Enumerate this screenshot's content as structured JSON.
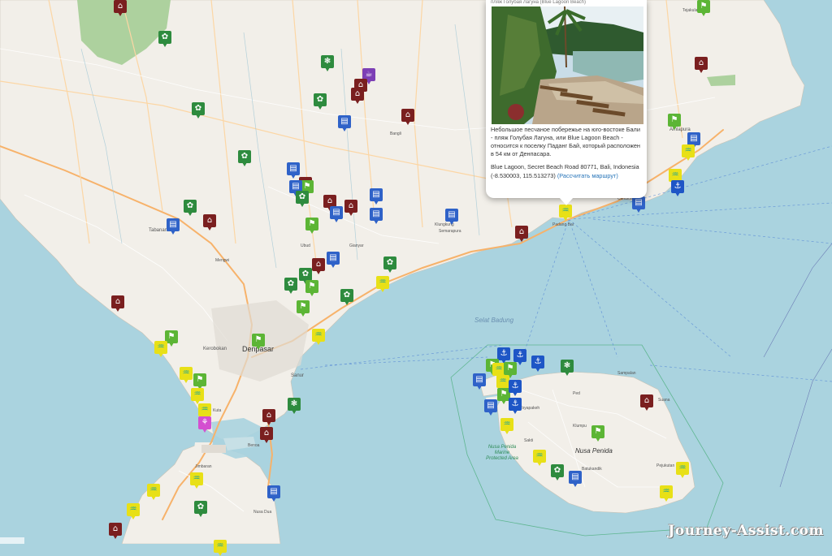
{
  "map": {
    "place_labels": {
      "denpasar": "Denpasar",
      "kerobokan": "Kerobokan",
      "sanur": "Sanur",
      "nusa_penida": "Nusa Penida",
      "nusa_penida_mpa": "Nusa Penida Marine Protected Area",
      "selat_badung": "Selat Badung",
      "amlapura": "Amlapura",
      "bangli": "Bangli",
      "tabanan": "Tabanan",
      "gianyar": "Gianyar",
      "klungkung": "Klungkung",
      "semarapura": "Semarapura",
      "ubud": "Ubud",
      "sampalan": "Sampalan",
      "kuta": "Kuta",
      "nusa_dua": "Nusa Dua",
      "benoa": "Benoa",
      "jimbaran": "Jimbaran",
      "mengwi": "Mengwi",
      "padang_bai": "Padang Bai",
      "candidasa": "Candidasa",
      "tejakula": "Tejakula",
      "klumpu": "Klumpu",
      "ped": "Ped",
      "batukandik": "Batukandik",
      "pejukutan": "Pejukutan",
      "toyapakeh": "Toyapakeh",
      "sakti": "Sakti",
      "suana": "Suana"
    },
    "popup": {
      "top_text": "пляж Голубая Лагуна (Blue Lagoon Beach)",
      "image_alt": "Blue Lagoon beach photo",
      "description": "Небольшое песчаное побережье на юго-востоке Бали - пляж Голубая Лагуна, или Blue Lagoon Beach - относится к поселку Паданг Бай, который расположен в 54 км от Денпасара.",
      "address": "Blue Lagoon, Secret Beach Road 80771, Bali, Indonesia (-8.530003, 115.513273)",
      "route_link": "(Рассчитать маршрут)"
    },
    "marker_icons": {
      "temple": "temple-icon",
      "nature": "flower-icon",
      "flag": "flag-icon",
      "hotel": "building-icon",
      "beach": "palm-beach-icon",
      "dive": "diver-icon",
      "animal": "paw-icon",
      "cafe": "cup-icon",
      "spa": "lotus-icon"
    },
    "colors": {
      "sea": "#aad3df",
      "land": "#f2efe9",
      "forest": "#add19e",
      "road": "#f7b26a",
      "marker_temple": "#7a1f1f",
      "marker_green": "#2e8b3e",
      "marker_blue": "#2f62c8",
      "marker_beach": "#e8e017"
    },
    "watermark": "Journey-Assist.com"
  }
}
